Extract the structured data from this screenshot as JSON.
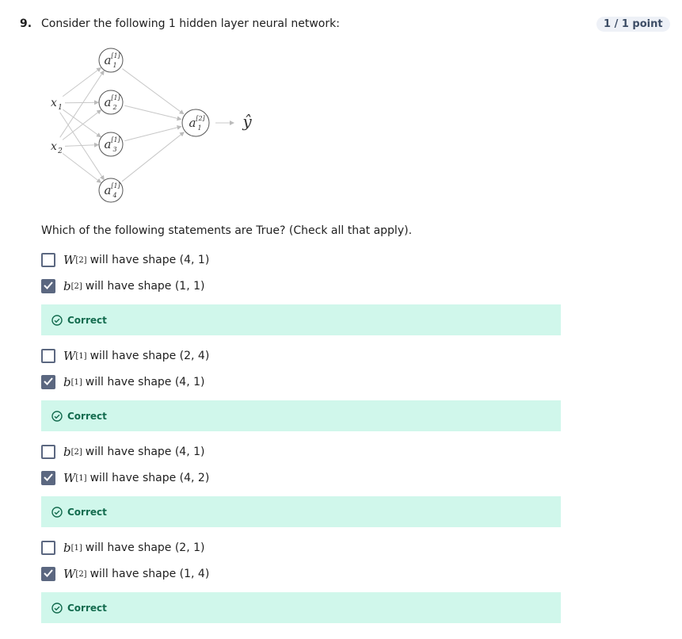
{
  "question": {
    "number": "9.",
    "title": "Consider the following 1 hidden layer neural network:",
    "score": "1 / 1 point",
    "prompt": "Which of the following statements are True? (Check all that apply)."
  },
  "diagram": {
    "inputs": [
      "x1",
      "x2"
    ],
    "hidden": [
      "a1[1]",
      "a2[1]",
      "a3[1]",
      "a4[1]"
    ],
    "output": "a1[2]",
    "prediction": "ŷ"
  },
  "feedback_label": "Correct",
  "colors": {
    "feedback_bg": "#d0f7eb",
    "feedback_text": "#146c4f",
    "checkbox": "#5b6780"
  },
  "options": [
    {
      "var": "W",
      "sup": "[2]",
      "text": "will have shape (4, 1)",
      "checked": false
    },
    {
      "var": "b",
      "sup": "[2]",
      "text": "will have shape (1, 1)",
      "checked": true
    },
    {
      "var": "W",
      "sup": "[1]",
      "text": "will have shape (2, 4)",
      "checked": false
    },
    {
      "var": "b",
      "sup": "[1]",
      "text": "will have shape (4, 1)",
      "checked": true
    },
    {
      "var": "b",
      "sup": "[2]",
      "text": "will have shape (4, 1)",
      "checked": false
    },
    {
      "var": "W",
      "sup": "[1]",
      "text": "will have shape (4, 2)",
      "checked": true
    },
    {
      "var": "b",
      "sup": "[1]",
      "text": "will have shape (2, 1)",
      "checked": false
    },
    {
      "var": "W",
      "sup": "[2]",
      "text": "will have shape (1, 4)",
      "checked": true
    }
  ]
}
